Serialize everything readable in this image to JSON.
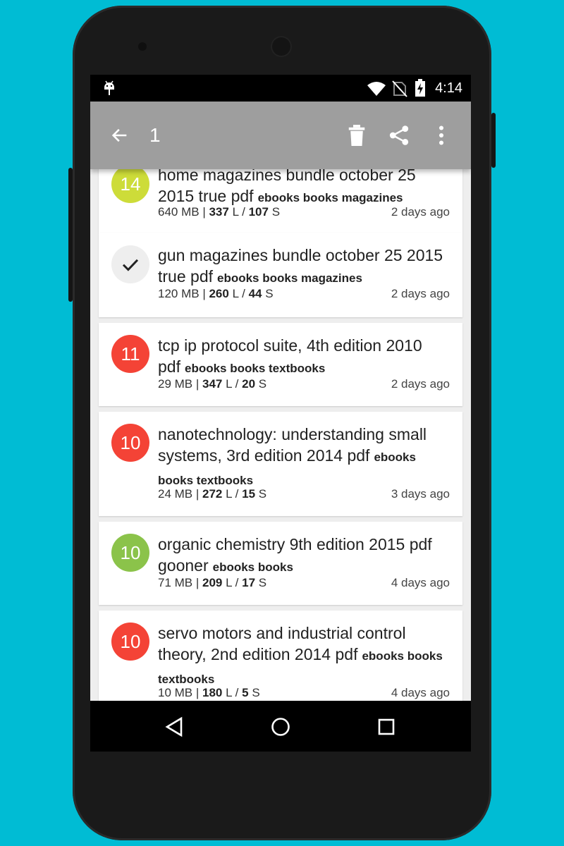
{
  "status": {
    "time": "4:14"
  },
  "appbar": {
    "selected_count": "1"
  },
  "items": [
    {
      "badge": "14",
      "badge_color": "#cddc39",
      "title": "home magazines bundle october 25 2015 true pdf",
      "tags": "ebooks books magazines",
      "size": "640 MB",
      "leechers": "337",
      "leechers_unit": "L",
      "seeders": "107",
      "seeders_unit": "S",
      "age": "2 days ago"
    },
    {
      "badge": "",
      "badge_color": "#eeeeee",
      "selected": true,
      "title": "gun magazines bundle october 25 2015 true pdf",
      "tags": "ebooks books magazines",
      "size": "120 MB",
      "leechers": "260",
      "leechers_unit": "L",
      "seeders": "44",
      "seeders_unit": "S",
      "age": "2 days ago"
    },
    {
      "badge": "11",
      "badge_color": "#f44336",
      "title": "tcp ip protocol suite, 4th edition 2010 pdf",
      "tags": "ebooks books textbooks",
      "size": "29 MB",
      "leechers": "347",
      "leechers_unit": "L",
      "seeders": "20",
      "seeders_unit": "S",
      "age": "2 days ago"
    },
    {
      "badge": "10",
      "badge_color": "#f44336",
      "title": "nanotechnology: understanding small systems, 3rd edition 2014 pdf",
      "tags": "ebooks books textbooks",
      "size": "24 MB",
      "leechers": "272",
      "leechers_unit": "L",
      "seeders": "15",
      "seeders_unit": "S",
      "age": "3 days ago"
    },
    {
      "badge": "10",
      "badge_color": "#8bc34a",
      "title": "organic chemistry 9th edition 2015 pdf gooner",
      "tags": "ebooks books",
      "size": "71 MB",
      "leechers": "209",
      "leechers_unit": "L",
      "seeders": "17",
      "seeders_unit": "S",
      "age": "4 days ago"
    },
    {
      "badge": "10",
      "badge_color": "#f44336",
      "title": "servo motors and industrial control theory, 2nd edition 2014 pdf",
      "tags": "ebooks books textbooks",
      "size": "10 MB",
      "leechers": "180",
      "leechers_unit": "L",
      "seeders": "5",
      "seeders_unit": "S",
      "age": "4 days ago"
    }
  ],
  "icons": {
    "back": "arrow-back-icon",
    "delete": "trash-icon",
    "share": "share-icon",
    "more": "more-vert-icon",
    "check": "check-icon",
    "nav_back": "triangle-back-icon",
    "nav_home": "circle-home-icon",
    "nav_recents": "square-recents-icon"
  }
}
